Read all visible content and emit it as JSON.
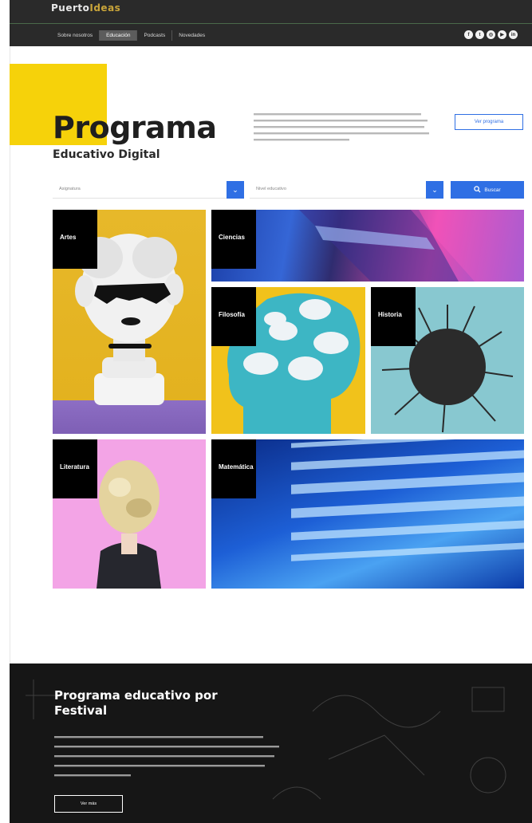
{
  "header": {
    "logo_prefix": "Puerto",
    "logo_suffix": "Ideas",
    "nav": [
      "Sobre nosotros",
      "Educación",
      "Podcasts",
      "Novedades"
    ],
    "active_nav": "Educación",
    "social_icons": [
      "facebook-icon",
      "twitter-icon",
      "instagram-icon",
      "youtube-icon",
      "linkedin-icon"
    ]
  },
  "hero": {
    "title": "Programa",
    "subtitle": "Educativo Digital",
    "cta_label": "Ver programa"
  },
  "filters": {
    "subject_placeholder": "Asignatura",
    "level_placeholder": "Nivel educativo",
    "search_label": "Buscar"
  },
  "categories": [
    "Artes",
    "Ciencias",
    "Filosofía",
    "Historia",
    "Literatura",
    "Matemática"
  ],
  "festival": {
    "title": "Programa educativo por Festival",
    "button_label": "Ver más"
  },
  "colors": {
    "accent_blue": "#2f6fe4",
    "yellow": "#f6d20a",
    "dark": "#161616"
  }
}
